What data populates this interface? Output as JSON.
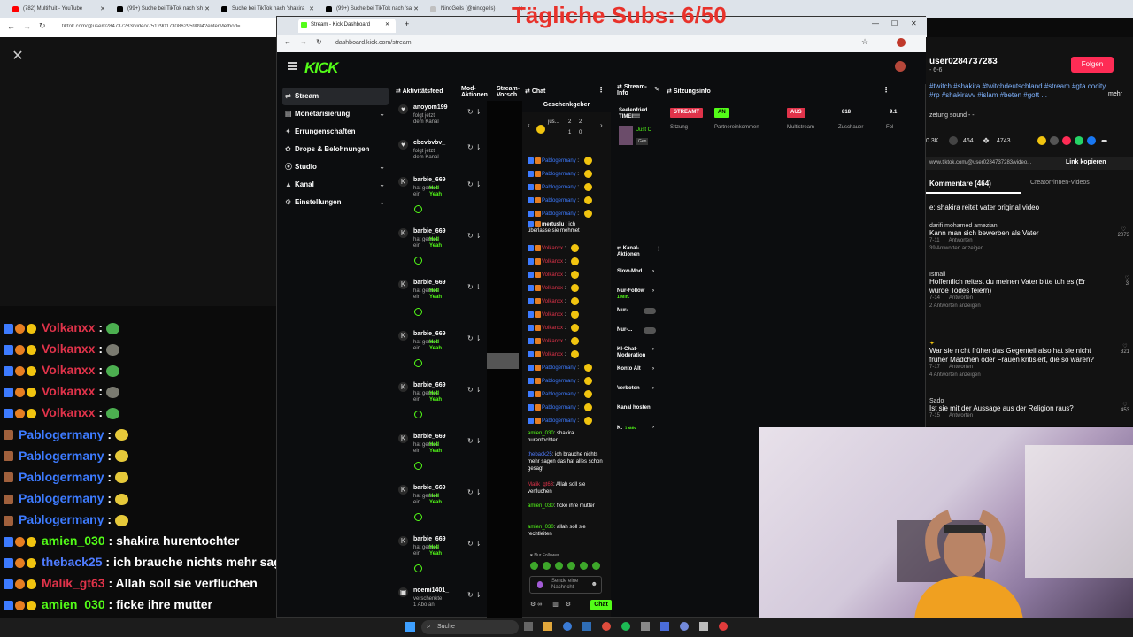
{
  "overlay": {
    "title": "Tägliche Subs: 6/50"
  },
  "browser_back": {
    "tabs": [
      "(782) Multifruit - YouTube",
      "(99+) Suche bei TikTok nach 'sh",
      "Suche bei TikTok nach 'shakira",
      "(99+) Suche bei TikTok nach 'sa",
      "NinoGeils (@ninogeils)"
    ],
    "url": "tiktok.com/@user0284737283/video/7512901730862959894?enterMethod="
  },
  "kick_window": {
    "tab_title": "Stream - Kick Dashboard",
    "url": "dashboard.kick.com/stream",
    "logo": "KICK",
    "sidebar": [
      {
        "label": "Stream",
        "icon": "stream-icon",
        "active": true
      },
      {
        "label": "Monetarisierung",
        "icon": "money-icon",
        "chevron": true
      },
      {
        "label": "Errungenschaften",
        "icon": "trophy-icon"
      },
      {
        "label": "Drops & Belohnungen",
        "icon": "gift-icon"
      },
      {
        "label": "Studio",
        "icon": "studio-icon",
        "chevron": true
      },
      {
        "label": "Kanal",
        "icon": "channel-icon",
        "chevron": true
      },
      {
        "label": "Einstellungen",
        "icon": "gear-icon",
        "chevron": true
      }
    ],
    "columns": {
      "feed": "Aktivitätsfeed",
      "mod": "Mod-Aktionen",
      "preview": "Stream-Vorsch",
      "chat": "Chat",
      "streaminfo": "Stream-Info",
      "session": "Sitzungsinfo"
    },
    "feed_items": [
      {
        "name": "anoyom199",
        "text": "folgt jetzt dem Kanal",
        "icon": "♥"
      },
      {
        "name": "cbcvbvbv_",
        "text": "folgt jetzt dem Kanal",
        "icon": "♥"
      },
      {
        "name": "barbie_669",
        "text": "hat gerade ein",
        "gift": "Hell Yeah",
        "icon": "K"
      },
      {
        "name": "barbie_669",
        "text": "hat gerade ein",
        "gift": "Hell Yeah",
        "icon": "K"
      },
      {
        "name": "barbie_669",
        "text": "hat gerade ein",
        "gift": "Hell Yeah",
        "icon": "K"
      },
      {
        "name": "barbie_669",
        "text": "hat gerade ein",
        "gift": "Hell Yeah",
        "icon": "K"
      },
      {
        "name": "barbie_669",
        "text": "hat gerade ein",
        "gift": "Hell Yeah",
        "icon": "K"
      },
      {
        "name": "barbie_669",
        "text": "hat gerade ein",
        "gift": "Hell Yeah",
        "icon": "K"
      },
      {
        "name": "barbie_669",
        "text": "hat gerade ein",
        "gift": "Hell Yeah",
        "icon": "K"
      },
      {
        "name": "barbie_669",
        "text": "hat gerade ein",
        "gift": "Hell Yeah",
        "icon": "K"
      },
      {
        "name": "noemi1401_",
        "text": "verschenkte 1 Abo an:",
        "icon": "▣"
      }
    ],
    "gifter_header": "Geschenkgeber",
    "gifter": {
      "name": "jus...",
      "c1": "2",
      "c2": "2",
      "c3": "1",
      "c4": "0"
    },
    "chat_lines": [
      {
        "user": "Pablogermany",
        "color": "#3d7bff"
      },
      {
        "user": "Pablogermany",
        "color": "#3d7bff"
      },
      {
        "user": "Pablogermany",
        "color": "#3d7bff"
      },
      {
        "user": "Pablogermany",
        "color": "#3d7bff"
      },
      {
        "user": "Pablogermany",
        "color": "#3d7bff"
      },
      {
        "user": "mertuslu",
        "color": "#ffffff",
        "msg": "ich überlasse sie mehmet"
      },
      {
        "user": "Volkanxx",
        "color": "#e0334a"
      },
      {
        "user": "Volkanxx",
        "color": "#e0334a"
      },
      {
        "user": "Volkanxx",
        "color": "#e0334a"
      },
      {
        "user": "Volkanxx",
        "color": "#e0334a"
      },
      {
        "user": "Volkanxx",
        "color": "#e0334a"
      },
      {
        "user": "Volkanxx",
        "color": "#e0334a"
      },
      {
        "user": "Volkanxx",
        "color": "#e0334a"
      },
      {
        "user": "Volkanxx",
        "color": "#e0334a"
      },
      {
        "user": "Volkanxx",
        "color": "#e0334a"
      },
      {
        "user": "Pablogermany",
        "color": "#3d7bff"
      },
      {
        "user": "Pablogermany",
        "color": "#3d7bff"
      },
      {
        "user": "Pablogermany",
        "color": "#3d7bff"
      },
      {
        "user": "Pablogermany",
        "color": "#3d7bff"
      },
      {
        "user": "Pablogermany",
        "color": "#3d7bff"
      }
    ],
    "chat_msgs": [
      {
        "user": "amien_030",
        "color": "#53fc18",
        "msg": "shakira hurentochter"
      },
      {
        "user": "theback25",
        "color": "#4f7cff",
        "msg": "ich brauche nichts mehr sagen das hat alles schon gesagt"
      },
      {
        "user": "Malik_gt63",
        "color": "#e0334a",
        "msg": "Allah soll sie verfluchen"
      },
      {
        "user": "amien_030",
        "color": "#53fc18",
        "msg": "ficke ihre mutter"
      },
      {
        "user": "amien_030",
        "color": "#53fc18",
        "msg": "allah soll sie rechtleiten"
      }
    ],
    "chat_input": {
      "follower_only": "Nur Follower",
      "placeholder": "Sende eine Nachricht",
      "send": "Chat"
    },
    "stream_info": {
      "name": "Seelenfried TIMEl!!!!",
      "sub": "Just C",
      "gen": "Gen"
    },
    "session": [
      {
        "pill": "STREAMT",
        "pill_color": "#e0334a",
        "label": "Sitzung"
      },
      {
        "pill": "AN",
        "pill_color": "#53fc18",
        "label": "Partnereinkommen"
      },
      {
        "pill": "AUS",
        "pill_color": "#e0334a",
        "label": "Multistream"
      },
      {
        "pill": "818",
        "pill_color": "",
        "label": "Zuschauer"
      },
      {
        "pill": "9.1",
        "pill_color": "",
        "label": "Fol"
      }
    ],
    "channel_actions": {
      "title": "Kanal-Aktionen",
      "items": [
        "Slow-Mod",
        "Nur-Follow",
        "Nur-...",
        "Nur-...",
        "KI-Chat-Moderation",
        "Konto Alt",
        "Verboten",
        "Kanal hosten",
        "K."
      ],
      "sub": "1 Min.",
      "k_status": "1 aktiv"
    }
  },
  "tiktok_right": {
    "user": "user0284737283",
    "handle": "- 6-6",
    "follow": "Folgen",
    "hashtags": "#twitch #shakira #twitchdeutschland #stream #gta cocity #rp #shakiravv #islam #beten #gott ...",
    "more": "mehr",
    "sound": "zetung sound - -",
    "stats": {
      "likes": "0.3K",
      "comments": "464",
      "shares": "4743"
    },
    "link": "www.tiktok.com/@user0284737283/video...",
    "copy": "Link kopieren",
    "tab_comments": "Kommentare (464)",
    "tab_creators": "Creator*innen-Videos",
    "caption": "e: shakira reitet vater original video",
    "comments": [
      {
        "name": "darifi mohamed amezian",
        "text": "Kann man sich bewerben als Vater",
        "date": "7-11",
        "reply": "Antworten",
        "more": "39 Antworten anzeigen",
        "likes": "2073"
      },
      {
        "name": "Ismail",
        "text": "Hoffentlich reitest du meinen Vater bitte tuh es (Er würde Todes feiern)",
        "date": "7-14",
        "reply": "Antworten",
        "more": "2 Antworten anzeigen",
        "likes": "3"
      },
      {
        "name": "",
        "text": "War sie nicht früher das Gegenteil also hat sie nicht früher Mädchen oder Frauen kritisiert, die so waren?",
        "date": "7-17",
        "reply": "Antworten",
        "more": "4 Antworten anzeigen",
        "likes": "321"
      },
      {
        "name": "Sado",
        "text": "Ist sie mit der Aussage aus der Religion raus?",
        "date": "7-15",
        "reply": "Antworten",
        "more": "",
        "likes": "453"
      }
    ]
  },
  "overlay_chat": [
    {
      "user": "Volkanxx",
      "color": "#e0334a",
      "msg": "",
      "emote": "green"
    },
    {
      "user": "Volkanxx",
      "color": "#e0334a",
      "msg": "",
      "emote": "grey"
    },
    {
      "user": "Volkanxx",
      "color": "#e0334a",
      "msg": "",
      "emote": "green"
    },
    {
      "user": "Volkanxx",
      "color": "#e0334a",
      "msg": "",
      "emote": "grey"
    },
    {
      "user": "Volkanxx",
      "color": "#e0334a",
      "msg": "",
      "emote": "green"
    },
    {
      "user": "Pablogermany",
      "color": "#3d7bff",
      "msg": "",
      "emote": "yellow"
    },
    {
      "user": "Pablogermany",
      "color": "#3d7bff",
      "msg": "",
      "emote": "yellow"
    },
    {
      "user": "Pablogermany",
      "color": "#3d7bff",
      "msg": "",
      "emote": "yellow"
    },
    {
      "user": "Pablogermany",
      "color": "#3d7bff",
      "msg": "",
      "emote": "yellow"
    },
    {
      "user": "Pablogermany",
      "color": "#3d7bff",
      "msg": "",
      "emote": "yellow"
    },
    {
      "user": "amien_030",
      "color": "#53fc18",
      "msg": "shakira hurentochter",
      "emote": ""
    },
    {
      "user": "theback25",
      "color": "#4f7cff",
      "msg": "ich brauche nichts mehr sagen das hat alles schon gesagt",
      "emote": ""
    },
    {
      "user": "Malik_gt63",
      "color": "#e0334a",
      "msg": "Allah soll sie verfluchen",
      "emote": ""
    },
    {
      "user": "amien_030",
      "color": "#53fc18",
      "msg": "ficke ihre mutter",
      "emote": ""
    },
    {
      "user": "amien_030",
      "color": "#53fc18",
      "msg": "allah soll sie rechtleiten",
      "emote": ""
    }
  ],
  "taskbar": {
    "search": "Suche"
  }
}
